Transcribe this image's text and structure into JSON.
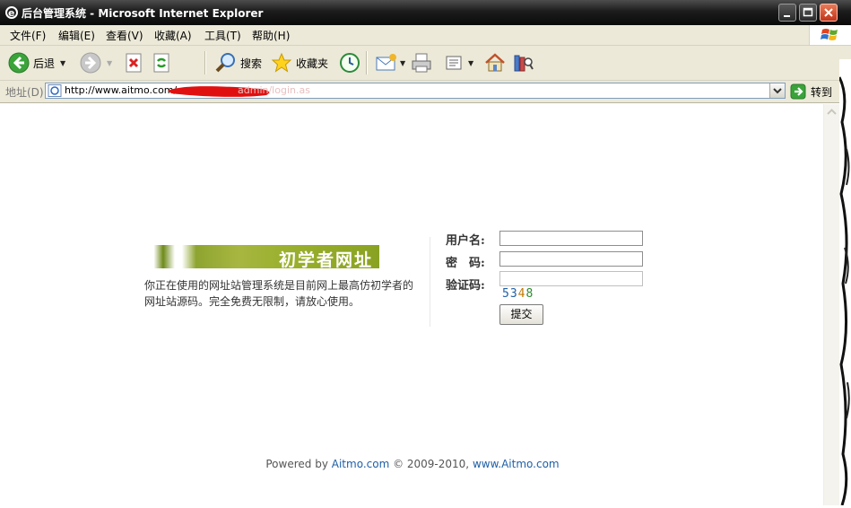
{
  "window": {
    "title": "后台管理系统 - Microsoft Internet Explorer"
  },
  "menu": {
    "items": [
      "文件(F)",
      "编辑(E)",
      "查看(V)",
      "收藏(A)",
      "工具(T)",
      "帮助(H)"
    ]
  },
  "toolbar": {
    "back_label": "后退",
    "search_label": "搜索",
    "favorites_label": "收藏夹"
  },
  "address": {
    "label": "地址(D)",
    "url_visible": "http://www.aitmo.com/",
    "url_tail": "admin/login.as",
    "go_label": "转到"
  },
  "page": {
    "banner_text": "初学者网址",
    "intro_text": "你正在使用的网址站管理系统是目前网上最高仿初学者的网址站源码。完全免费无限制，请放心使用。",
    "form": {
      "username_label": "用户名:",
      "password_label": "密　码:",
      "captcha_label": "验证码:",
      "captcha_digits": [
        "5",
        "3",
        "4",
        "8"
      ],
      "captcha_colors": [
        "#1f5fa6",
        "#1f5fa6",
        "#c07a00",
        "#2e8b2e"
      ],
      "submit_label": "提交"
    },
    "footer": {
      "prefix": "Powered by ",
      "brand_link": "Aitmo.com",
      "middle": " © 2009-2010, ",
      "site_link": "www.Aitmo.com"
    }
  },
  "colors": {
    "titlebar": "#1c1c1c",
    "chrome": "#ece9d8",
    "link": "#1f5fa6",
    "banner": "#8aa222"
  }
}
